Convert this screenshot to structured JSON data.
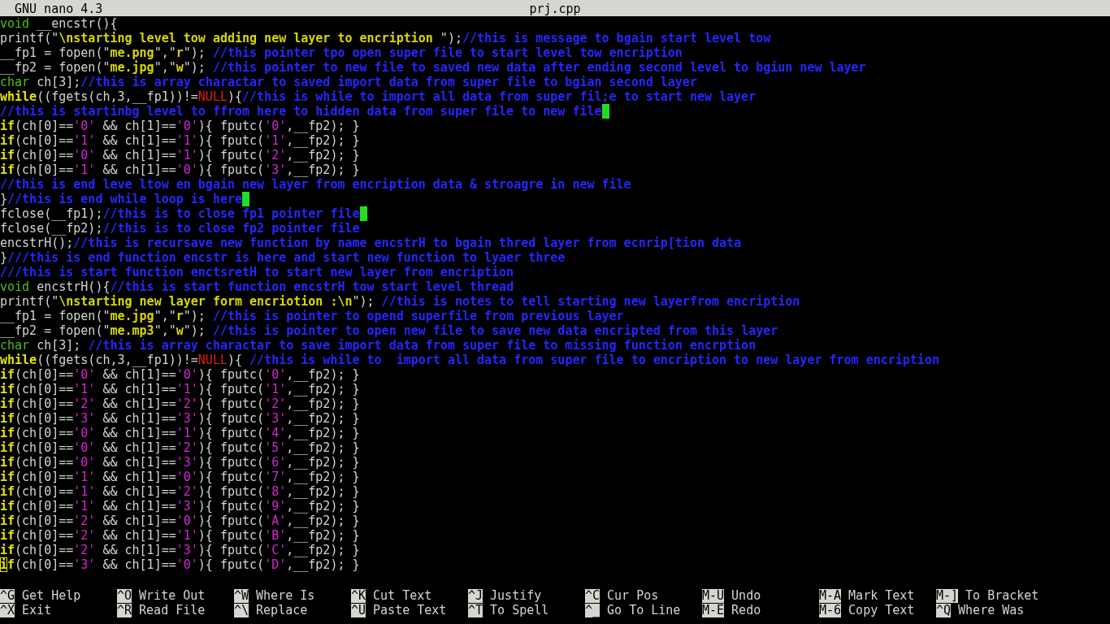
{
  "title_bar": {
    "app": "GNU nano 4.3",
    "file": "prj.cpp"
  },
  "lines": [
    {
      "segments": [
        {
          "kind": "type",
          "text": "void"
        },
        {
          "kind": "plain",
          "text": " __encstr(){"
        }
      ]
    },
    {
      "segments": [
        {
          "kind": "plain",
          "text": "printf(\""
        },
        {
          "kind": "string",
          "text": "\\nstarting level tow adding new layer to encription "
        },
        {
          "kind": "plain",
          "text": "\");"
        },
        {
          "kind": "comment",
          "text": "//this is message to bgain start level tow"
        }
      ]
    },
    {
      "segments": [
        {
          "kind": "plain",
          "text": "__fp1 = fopen(\""
        },
        {
          "kind": "string",
          "text": "me.png"
        },
        {
          "kind": "plain",
          "text": "\",\""
        },
        {
          "kind": "string",
          "text": "r"
        },
        {
          "kind": "plain",
          "text": "\"); "
        },
        {
          "kind": "comment",
          "text": "//this pointer tpo open super file to start level tow encription"
        }
      ]
    },
    {
      "segments": [
        {
          "kind": "plain",
          "text": "__fp2 = fopen(\""
        },
        {
          "kind": "string",
          "text": "me.jpg"
        },
        {
          "kind": "plain",
          "text": "\",\""
        },
        {
          "kind": "string",
          "text": "w"
        },
        {
          "kind": "plain",
          "text": "\"); "
        },
        {
          "kind": "comment",
          "text": "//this pointer to new file to saved new data after ending second level to bgiun new layer"
        }
      ]
    },
    {
      "segments": [
        {
          "kind": "type",
          "text": "char"
        },
        {
          "kind": "plain",
          "text": " ch[3];"
        },
        {
          "kind": "comment",
          "text": "//this is array charactar to saved import data from super file to bgian second layer"
        }
      ]
    },
    {
      "segments": [
        {
          "kind": "keyword",
          "text": "while"
        },
        {
          "kind": "plain",
          "text": "((fgets(ch,3,__fp1))!="
        },
        {
          "kind": "null",
          "text": "NULL"
        },
        {
          "kind": "plain",
          "text": "){"
        },
        {
          "kind": "comment",
          "text": "//this is while to import all data from super fil;e to start new layer"
        }
      ]
    },
    {
      "trailing_whitespace": true,
      "segments": [
        {
          "kind": "comment",
          "text": "//this is startinbg level to ffrom here to hidden data from super file to new file"
        }
      ]
    },
    {
      "segments": [
        {
          "kind": "keyword",
          "text": "if"
        },
        {
          "kind": "plain",
          "text": "(ch[0]=="
        },
        {
          "kind": "char",
          "text": "'0'"
        },
        {
          "kind": "plain",
          "text": " && ch[1]=="
        },
        {
          "kind": "char",
          "text": "'0'"
        },
        {
          "kind": "plain",
          "text": "){ fputc("
        },
        {
          "kind": "char",
          "text": "'0'"
        },
        {
          "kind": "plain",
          "text": ",__fp2); }"
        }
      ]
    },
    {
      "segments": [
        {
          "kind": "keyword",
          "text": "if"
        },
        {
          "kind": "plain",
          "text": "(ch[0]=="
        },
        {
          "kind": "char",
          "text": "'1'"
        },
        {
          "kind": "plain",
          "text": " && ch[1]=="
        },
        {
          "kind": "char",
          "text": "'1'"
        },
        {
          "kind": "plain",
          "text": "){ fputc("
        },
        {
          "kind": "char",
          "text": "'1'"
        },
        {
          "kind": "plain",
          "text": ",__fp2); }"
        }
      ]
    },
    {
      "segments": [
        {
          "kind": "keyword",
          "text": "if"
        },
        {
          "kind": "plain",
          "text": "(ch[0]=="
        },
        {
          "kind": "char",
          "text": "'0'"
        },
        {
          "kind": "plain",
          "text": " && ch[1]=="
        },
        {
          "kind": "char",
          "text": "'1'"
        },
        {
          "kind": "plain",
          "text": "){ fputc("
        },
        {
          "kind": "char",
          "text": "'2'"
        },
        {
          "kind": "plain",
          "text": ",__fp2); }"
        }
      ]
    },
    {
      "segments": [
        {
          "kind": "keyword",
          "text": "if"
        },
        {
          "kind": "plain",
          "text": "(ch[0]=="
        },
        {
          "kind": "char",
          "text": "'1'"
        },
        {
          "kind": "plain",
          "text": " && ch[1]=="
        },
        {
          "kind": "char",
          "text": "'0'"
        },
        {
          "kind": "plain",
          "text": "){ fputc("
        },
        {
          "kind": "char",
          "text": "'3'"
        },
        {
          "kind": "plain",
          "text": ",__fp2); }"
        }
      ]
    },
    {
      "segments": [
        {
          "kind": "comment",
          "text": "//this is end leve ltow en bgain new layer from encription data & stroagre in new file"
        }
      ]
    },
    {
      "trailing_whitespace": true,
      "segments": [
        {
          "kind": "plain",
          "text": "}"
        },
        {
          "kind": "comment",
          "text": "//this is end while loop is here"
        }
      ]
    },
    {
      "trailing_whitespace": true,
      "segments": [
        {
          "kind": "plain",
          "text": "fclose(__fp1);"
        },
        {
          "kind": "comment",
          "text": "//this is to close fp1 pointer file"
        }
      ]
    },
    {
      "segments": [
        {
          "kind": "plain",
          "text": "fclose(__fp2);"
        },
        {
          "kind": "comment",
          "text": "//this is to close fp2 pointer file"
        }
      ]
    },
    {
      "segments": [
        {
          "kind": "plain",
          "text": "encstrH();"
        },
        {
          "kind": "comment",
          "text": "//this is recursave new function by name encstrH to bgain thred layer from ecnrip[tion data"
        }
      ]
    },
    {
      "segments": [
        {
          "kind": "plain",
          "text": "}"
        },
        {
          "kind": "comment",
          "text": "///this is end function encstr is here and start new function to lyaer three"
        }
      ]
    },
    {
      "segments": [
        {
          "kind": "comment",
          "text": "///this is start function enctsretH to start new layer from encription"
        }
      ]
    },
    {
      "segments": [
        {
          "kind": "type",
          "text": "void"
        },
        {
          "kind": "plain",
          "text": " encstrH(){"
        },
        {
          "kind": "comment",
          "text": "//this is start function encstrH tow start level thread"
        }
      ]
    },
    {
      "segments": [
        {
          "kind": "plain",
          "text": "printf(\""
        },
        {
          "kind": "string",
          "text": "\\nstarting new layer form encriotion :\\n"
        },
        {
          "kind": "plain",
          "text": "\"); "
        },
        {
          "kind": "comment",
          "text": "//this is notes to tell starting new layerfrom encription"
        }
      ]
    },
    {
      "segments": [
        {
          "kind": "plain",
          "text": "__fp1 = fopen(\""
        },
        {
          "kind": "string",
          "text": "me.jpg"
        },
        {
          "kind": "plain",
          "text": "\",\""
        },
        {
          "kind": "string",
          "text": "r"
        },
        {
          "kind": "plain",
          "text": "\"); "
        },
        {
          "kind": "comment",
          "text": "//this is pointer to opend superfile from previous layer"
        }
      ]
    },
    {
      "segments": [
        {
          "kind": "plain",
          "text": "__fp2 = fopen(\""
        },
        {
          "kind": "string",
          "text": "me.mp3"
        },
        {
          "kind": "plain",
          "text": "\",\""
        },
        {
          "kind": "string",
          "text": "w"
        },
        {
          "kind": "plain",
          "text": "\"); "
        },
        {
          "kind": "comment",
          "text": "//this is pointer to open new file to save new data encripted from this layer"
        }
      ]
    },
    {
      "segments": [
        {
          "kind": "type",
          "text": "char"
        },
        {
          "kind": "plain",
          "text": " ch[3]; "
        },
        {
          "kind": "comment",
          "text": "//this is array charactar to save import data from super file to missing function encrption"
        }
      ]
    },
    {
      "segments": [
        {
          "kind": "keyword",
          "text": "while"
        },
        {
          "kind": "plain",
          "text": "((fgets(ch,3,__fp1))!="
        },
        {
          "kind": "null",
          "text": "NULL"
        },
        {
          "kind": "plain",
          "text": "){ "
        },
        {
          "kind": "comment",
          "text": "//this is while to  import all data from super file to encription to new layer from encription"
        }
      ]
    },
    {
      "segments": [
        {
          "kind": "keyword",
          "text": "if"
        },
        {
          "kind": "plain",
          "text": "(ch[0]=="
        },
        {
          "kind": "char",
          "text": "'0'"
        },
        {
          "kind": "plain",
          "text": " && ch[1]=="
        },
        {
          "kind": "char",
          "text": "'0'"
        },
        {
          "kind": "plain",
          "text": "){ fputc("
        },
        {
          "kind": "char",
          "text": "'0'"
        },
        {
          "kind": "plain",
          "text": ",__fp2); }"
        }
      ]
    },
    {
      "segments": [
        {
          "kind": "keyword",
          "text": "if"
        },
        {
          "kind": "plain",
          "text": "(ch[0]=="
        },
        {
          "kind": "char",
          "text": "'1'"
        },
        {
          "kind": "plain",
          "text": " && ch[1]=="
        },
        {
          "kind": "char",
          "text": "'1'"
        },
        {
          "kind": "plain",
          "text": "){ fputc("
        },
        {
          "kind": "char",
          "text": "'1'"
        },
        {
          "kind": "plain",
          "text": ",__fp2); }"
        }
      ]
    },
    {
      "segments": [
        {
          "kind": "keyword",
          "text": "if"
        },
        {
          "kind": "plain",
          "text": "(ch[0]=="
        },
        {
          "kind": "char",
          "text": "'2'"
        },
        {
          "kind": "plain",
          "text": " && ch[1]=="
        },
        {
          "kind": "char",
          "text": "'2'"
        },
        {
          "kind": "plain",
          "text": "){ fputc("
        },
        {
          "kind": "char",
          "text": "'2'"
        },
        {
          "kind": "plain",
          "text": ",__fp2); }"
        }
      ]
    },
    {
      "segments": [
        {
          "kind": "keyword",
          "text": "if"
        },
        {
          "kind": "plain",
          "text": "(ch[0]=="
        },
        {
          "kind": "char",
          "text": "'3'"
        },
        {
          "kind": "plain",
          "text": " && ch[1]=="
        },
        {
          "kind": "char",
          "text": "'3'"
        },
        {
          "kind": "plain",
          "text": "){ fputc("
        },
        {
          "kind": "char",
          "text": "'3'"
        },
        {
          "kind": "plain",
          "text": ",__fp2); }"
        }
      ]
    },
    {
      "segments": [
        {
          "kind": "keyword",
          "text": "if"
        },
        {
          "kind": "plain",
          "text": "(ch[0]=="
        },
        {
          "kind": "char",
          "text": "'0'"
        },
        {
          "kind": "plain",
          "text": " && ch[1]=="
        },
        {
          "kind": "char",
          "text": "'1'"
        },
        {
          "kind": "plain",
          "text": "){ fputc("
        },
        {
          "kind": "char",
          "text": "'4'"
        },
        {
          "kind": "plain",
          "text": ",__fp2); }"
        }
      ]
    },
    {
      "segments": [
        {
          "kind": "keyword",
          "text": "if"
        },
        {
          "kind": "plain",
          "text": "(ch[0]=="
        },
        {
          "kind": "char",
          "text": "'0'"
        },
        {
          "kind": "plain",
          "text": " && ch[1]=="
        },
        {
          "kind": "char",
          "text": "'2'"
        },
        {
          "kind": "plain",
          "text": "){ fputc("
        },
        {
          "kind": "char",
          "text": "'5'"
        },
        {
          "kind": "plain",
          "text": ",__fp2); }"
        }
      ]
    },
    {
      "segments": [
        {
          "kind": "keyword",
          "text": "if"
        },
        {
          "kind": "plain",
          "text": "(ch[0]=="
        },
        {
          "kind": "char",
          "text": "'0'"
        },
        {
          "kind": "plain",
          "text": " && ch[1]=="
        },
        {
          "kind": "char",
          "text": "'3'"
        },
        {
          "kind": "plain",
          "text": "){ fputc("
        },
        {
          "kind": "char",
          "text": "'6'"
        },
        {
          "kind": "plain",
          "text": ",__fp2); }"
        }
      ]
    },
    {
      "segments": [
        {
          "kind": "keyword",
          "text": "if"
        },
        {
          "kind": "plain",
          "text": "(ch[0]=="
        },
        {
          "kind": "char",
          "text": "'1'"
        },
        {
          "kind": "plain",
          "text": " && ch[1]=="
        },
        {
          "kind": "char",
          "text": "'0'"
        },
        {
          "kind": "plain",
          "text": "){ fputc("
        },
        {
          "kind": "char",
          "text": "'7'"
        },
        {
          "kind": "plain",
          "text": ",__fp2); }"
        }
      ]
    },
    {
      "segments": [
        {
          "kind": "keyword",
          "text": "if"
        },
        {
          "kind": "plain",
          "text": "(ch[0]=="
        },
        {
          "kind": "char",
          "text": "'1'"
        },
        {
          "kind": "plain",
          "text": " && ch[1]=="
        },
        {
          "kind": "char",
          "text": "'2'"
        },
        {
          "kind": "plain",
          "text": "){ fputc("
        },
        {
          "kind": "char",
          "text": "'8'"
        },
        {
          "kind": "plain",
          "text": ",__fp2); }"
        }
      ]
    },
    {
      "segments": [
        {
          "kind": "keyword",
          "text": "if"
        },
        {
          "kind": "plain",
          "text": "(ch[0]=="
        },
        {
          "kind": "char",
          "text": "'1'"
        },
        {
          "kind": "plain",
          "text": " && ch[1]=="
        },
        {
          "kind": "char",
          "text": "'3'"
        },
        {
          "kind": "plain",
          "text": "){ fputc("
        },
        {
          "kind": "char",
          "text": "'9'"
        },
        {
          "kind": "plain",
          "text": ",__fp2); }"
        }
      ]
    },
    {
      "segments": [
        {
          "kind": "keyword",
          "text": "if"
        },
        {
          "kind": "plain",
          "text": "(ch[0]=="
        },
        {
          "kind": "char",
          "text": "'2'"
        },
        {
          "kind": "plain",
          "text": " && ch[1]=="
        },
        {
          "kind": "char",
          "text": "'0'"
        },
        {
          "kind": "plain",
          "text": "){ fputc("
        },
        {
          "kind": "char",
          "text": "'A'"
        },
        {
          "kind": "plain",
          "text": ",__fp2); }"
        }
      ]
    },
    {
      "segments": [
        {
          "kind": "keyword",
          "text": "if"
        },
        {
          "kind": "plain",
          "text": "(ch[0]=="
        },
        {
          "kind": "char",
          "text": "'2'"
        },
        {
          "kind": "plain",
          "text": " && ch[1]=="
        },
        {
          "kind": "char",
          "text": "'1'"
        },
        {
          "kind": "plain",
          "text": "){ fputc("
        },
        {
          "kind": "char",
          "text": "'B'"
        },
        {
          "kind": "plain",
          "text": ",__fp2); }"
        }
      ]
    },
    {
      "segments": [
        {
          "kind": "keyword",
          "text": "if"
        },
        {
          "kind": "plain",
          "text": "(ch[0]=="
        },
        {
          "kind": "char",
          "text": "'2'"
        },
        {
          "kind": "plain",
          "text": " && ch[1]=="
        },
        {
          "kind": "char",
          "text": "'3'"
        },
        {
          "kind": "plain",
          "text": "){ fputc("
        },
        {
          "kind": "char",
          "text": "'C'"
        },
        {
          "kind": "plain",
          "text": ",__fp2); }"
        }
      ]
    },
    {
      "cursor": true,
      "segments": [
        {
          "kind": "keyword",
          "text": "if"
        },
        {
          "kind": "plain",
          "text": "(ch[0]=="
        },
        {
          "kind": "char",
          "text": "'3'"
        },
        {
          "kind": "plain",
          "text": " && ch[1]=="
        },
        {
          "kind": "char",
          "text": "'0'"
        },
        {
          "kind": "plain",
          "text": "){ fputc("
        },
        {
          "kind": "char",
          "text": "'D'"
        },
        {
          "kind": "plain",
          "text": ",__fp2); }"
        }
      ]
    }
  ],
  "shortcut_rows": [
    [
      {
        "key": "^G",
        "label": "Get Help"
      },
      {
        "key": "^O",
        "label": "Write Out"
      },
      {
        "key": "^W",
        "label": "Where Is"
      },
      {
        "key": "^K",
        "label": "Cut Text"
      },
      {
        "key": "^J",
        "label": "Justify"
      },
      {
        "key": "^C",
        "label": "Cur Pos"
      },
      {
        "key": "M-U",
        "label": "Undo"
      },
      {
        "key": "M-A",
        "label": "Mark Text"
      },
      {
        "key": "M-]",
        "label": "To Bracket"
      }
    ],
    [
      {
        "key": "^X",
        "label": "Exit"
      },
      {
        "key": "^R",
        "label": "Read File"
      },
      {
        "key": "^\\",
        "label": "Replace"
      },
      {
        "key": "^U",
        "label": "Paste Text"
      },
      {
        "key": "^T",
        "label": "To Spell"
      },
      {
        "key": "^_",
        "label": "Go To Line"
      },
      {
        "key": "M-E",
        "label": "Redo"
      },
      {
        "key": "M-6",
        "label": "Copy Text"
      },
      {
        "key": "^Q",
        "label": "Where Was"
      }
    ]
  ]
}
